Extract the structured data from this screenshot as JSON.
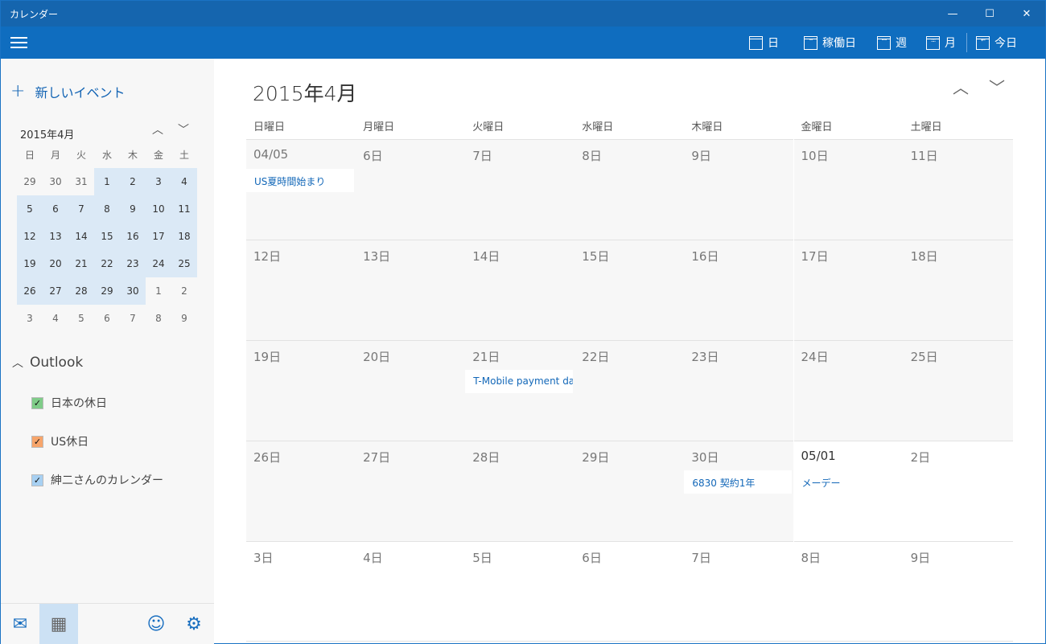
{
  "window": {
    "title": "カレンダー",
    "minimize": "—",
    "maximize": "☐",
    "close": "✕"
  },
  "toolbar": {
    "day": "日",
    "workweek": "稼働日",
    "week": "週",
    "month": "月",
    "today": "今日"
  },
  "sidebar": {
    "new_event": "新しいイベント",
    "mini_title": "2015年4月",
    "weekdays": [
      "日",
      "月",
      "火",
      "水",
      "木",
      "金",
      "土"
    ],
    "weeks": [
      [
        [
          "29",
          0
        ],
        [
          "30",
          0
        ],
        [
          "31",
          0
        ],
        [
          "1",
          1
        ],
        [
          "2",
          1
        ],
        [
          "3",
          1
        ],
        [
          "4",
          1
        ]
      ],
      [
        [
          "5",
          1
        ],
        [
          "6",
          1
        ],
        [
          "7",
          1
        ],
        [
          "8",
          1
        ],
        [
          "9",
          1
        ],
        [
          "10",
          1
        ],
        [
          "11",
          1
        ]
      ],
      [
        [
          "12",
          1
        ],
        [
          "13",
          1
        ],
        [
          "14",
          1
        ],
        [
          "15",
          1
        ],
        [
          "16",
          1
        ],
        [
          "17",
          1
        ],
        [
          "18",
          1
        ]
      ],
      [
        [
          "19",
          1
        ],
        [
          "20",
          1
        ],
        [
          "21",
          1
        ],
        [
          "22",
          1
        ],
        [
          "23",
          1
        ],
        [
          "24",
          1
        ],
        [
          "25",
          1
        ]
      ],
      [
        [
          "26",
          1
        ],
        [
          "27",
          1
        ],
        [
          "28",
          1
        ],
        [
          "29",
          1
        ],
        [
          "30",
          1
        ],
        [
          "1",
          0
        ],
        [
          "2",
          0
        ]
      ],
      [
        [
          "3",
          0
        ],
        [
          "4",
          0
        ],
        [
          "5",
          0
        ],
        [
          "6",
          0
        ],
        [
          "7",
          0
        ],
        [
          "8",
          0
        ],
        [
          "9",
          0
        ]
      ]
    ],
    "account": "Outlook",
    "calendars": [
      {
        "label": "日本の休日",
        "color": "#7fcc88"
      },
      {
        "label": "US休日",
        "color": "#f7a56b"
      },
      {
        "label": "紳二さんのカレンダー",
        "color": "#a7d0f2"
      }
    ]
  },
  "main": {
    "title": "2015年4月",
    "weekdays": [
      "日曜日",
      "月曜日",
      "火曜日",
      "水曜日",
      "木曜日",
      "金曜日",
      "土曜日"
    ],
    "weeks": [
      [
        {
          "d": "04/05",
          "cur": 1,
          "ev": "US夏時間始まり"
        },
        {
          "d": "6日",
          "cur": 1
        },
        {
          "d": "7日",
          "cur": 1
        },
        {
          "d": "8日",
          "cur": 1
        },
        {
          "d": "9日",
          "cur": 1
        },
        {
          "d": "10日",
          "cur": 1
        },
        {
          "d": "11日",
          "cur": 1
        }
      ],
      [
        {
          "d": "12日",
          "cur": 1
        },
        {
          "d": "13日",
          "cur": 1
        },
        {
          "d": "14日",
          "cur": 1
        },
        {
          "d": "15日",
          "cur": 1
        },
        {
          "d": "16日",
          "cur": 1
        },
        {
          "d": "17日",
          "cur": 1
        },
        {
          "d": "18日",
          "cur": 1
        }
      ],
      [
        {
          "d": "19日",
          "cur": 1
        },
        {
          "d": "20日",
          "cur": 1
        },
        {
          "d": "21日",
          "cur": 1,
          "ev": "T-Mobile payment date"
        },
        {
          "d": "22日",
          "cur": 1
        },
        {
          "d": "23日",
          "cur": 1
        },
        {
          "d": "24日",
          "cur": 1
        },
        {
          "d": "25日",
          "cur": 1
        }
      ],
      [
        {
          "d": "26日",
          "cur": 1
        },
        {
          "d": "27日",
          "cur": 1
        },
        {
          "d": "28日",
          "cur": 1
        },
        {
          "d": "29日",
          "cur": 1
        },
        {
          "d": "30日",
          "cur": 1,
          "ev": "6830 契約1年"
        },
        {
          "d": "05/01",
          "cur": 0,
          "bold": 1,
          "ev": "メーデー"
        },
        {
          "d": "2日",
          "cur": 0
        }
      ],
      [
        {
          "d": "3日",
          "cur": 0
        },
        {
          "d": "4日",
          "cur": 0
        },
        {
          "d": "5日",
          "cur": 0
        },
        {
          "d": "6日",
          "cur": 0
        },
        {
          "d": "7日",
          "cur": 0
        },
        {
          "d": "8日",
          "cur": 0
        },
        {
          "d": "9日",
          "cur": 0
        }
      ]
    ]
  }
}
